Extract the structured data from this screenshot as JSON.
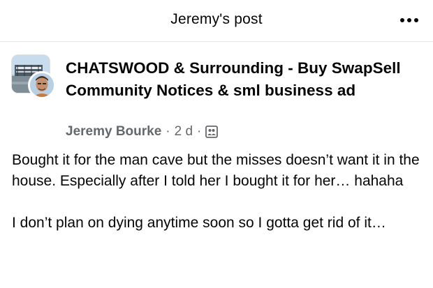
{
  "header": {
    "title": "Jeremy's post",
    "more_icon": "more-horizontal-icon"
  },
  "post": {
    "group_name": "CHATSWOOD & Surrounding - Buy SwapSell  Community Notices & sml business ad",
    "author": "Jeremy Bourke",
    "separator": "·",
    "time": "2 d",
    "audience_icon": "group-members-icon",
    "text": "Bought it for the man cave but the misses doesn’t want it in the house. Especially after I told her I bought it for her… hahaha\n\nI don’t plan on dying anytime soon so I gotta get rid of it…"
  },
  "colors": {
    "text_primary": "#050505",
    "text_secondary": "#65676b",
    "divider": "#e4e6eb"
  }
}
